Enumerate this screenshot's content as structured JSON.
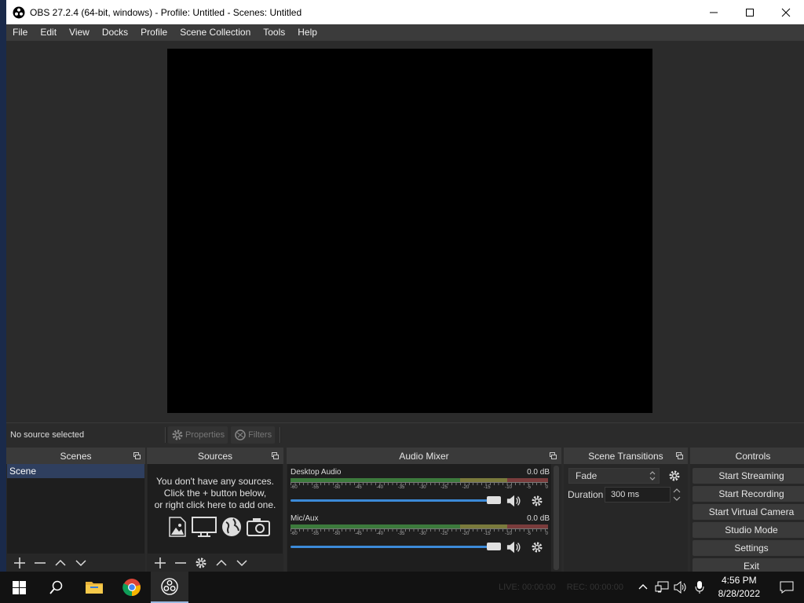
{
  "window": {
    "title": "OBS 27.2.4 (64-bit, windows) - Profile: Untitled - Scenes: Untitled"
  },
  "menu": [
    "File",
    "Edit",
    "View",
    "Docks",
    "Profile",
    "Scene Collection",
    "Tools",
    "Help"
  ],
  "context_bar": {
    "no_source": "No source selected",
    "properties_label": "Properties",
    "filters_label": "Filters"
  },
  "docks": {
    "scenes": {
      "title": "Scenes",
      "items": [
        "Scene"
      ]
    },
    "sources": {
      "title": "Sources",
      "empty_line1": "You don't have any sources.",
      "empty_line2": "Click the + button below,",
      "empty_line3": "or right click here to add one."
    },
    "mixer": {
      "title": "Audio Mixer",
      "channels": [
        {
          "name": "Desktop Audio",
          "db": "0.0 dB"
        },
        {
          "name": "Mic/Aux",
          "db": "0.0 dB"
        }
      ],
      "tick_labels": [
        "-60",
        "-55",
        "-50",
        "-45",
        "-40",
        "-35",
        "-30",
        "-25",
        "-20",
        "-15",
        "-10",
        "-5",
        "0"
      ]
    },
    "transitions": {
      "title": "Scene Transitions",
      "selected": "Fade",
      "duration_label": "Duration",
      "duration_value": "300 ms"
    },
    "controls": {
      "title": "Controls",
      "buttons": [
        "Start Streaming",
        "Start Recording",
        "Start Virtual Camera",
        "Studio Mode",
        "Settings",
        "Exit"
      ]
    }
  },
  "taskbar": {
    "status_live": "LIVE: 00:00:00",
    "status_rec": "REC: 00:00:00",
    "time": "4:56 PM",
    "date": "8/28/2022"
  },
  "colors": {
    "accent": "#3c8ad8",
    "scene_selected": "#2f3f5f",
    "panel": "#272727",
    "header": "#3a3a3a"
  }
}
